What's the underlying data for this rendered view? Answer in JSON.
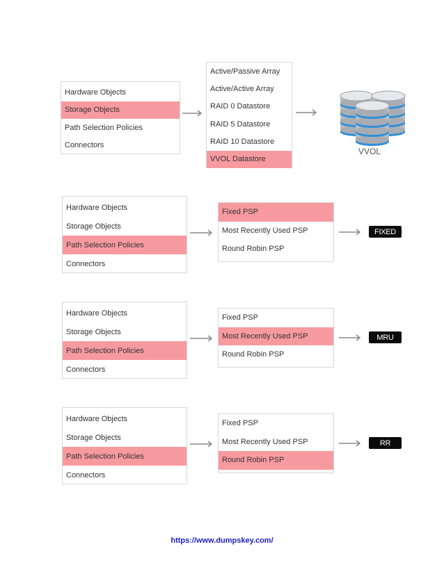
{
  "diagrams": [
    {
      "left": {
        "items": [
          "Hardware Objects",
          "Storage Objects",
          "Path Selection Policies",
          "Connectors"
        ],
        "selected": 1
      },
      "middle": {
        "items": [
          "Active/Passive Array",
          "Active/Active Array",
          "RAID 0 Datastore",
          "RAID 5 Datastore",
          "RAID 10 Datastore",
          "VVOL Datastore"
        ],
        "selected": 5
      },
      "result": {
        "type": "database-icon",
        "label": "VVOL"
      }
    },
    {
      "left": {
        "items": [
          "Hardware Objects",
          "Storage Objects",
          "Path Selection Policies",
          "Connectors"
        ],
        "selected": 2
      },
      "middle": {
        "items": [
          "Fixed PSP",
          "Most Recently Used PSP",
          "Round Robin PSP"
        ],
        "selected": 0
      },
      "result": {
        "type": "badge",
        "label": "FIXED"
      }
    },
    {
      "left": {
        "items": [
          "Hardware Objects",
          "Storage Objects",
          "Path Selection Policies",
          "Connectors"
        ],
        "selected": 2
      },
      "middle": {
        "items": [
          "Fixed PSP",
          "Most Recently Used PSP",
          "Round Robin PSP"
        ],
        "selected": 1
      },
      "result": {
        "type": "badge",
        "label": "MRU"
      }
    },
    {
      "left": {
        "items": [
          "Hardware Objects",
          "Storage Objects",
          "Path Selection Policies",
          "Connectors"
        ],
        "selected": 2
      },
      "middle": {
        "items": [
          "Fixed PSP",
          "Most Recently Used PSP",
          "Round Robin PSP"
        ],
        "selected": 2
      },
      "result": {
        "type": "badge",
        "label": "RR"
      }
    }
  ],
  "colors": {
    "highlight": "#f79a9f",
    "badge": "#0b0b0b",
    "link": "#1f1fbf"
  },
  "footer": {
    "link": "https://www.dumpskey.com/"
  }
}
